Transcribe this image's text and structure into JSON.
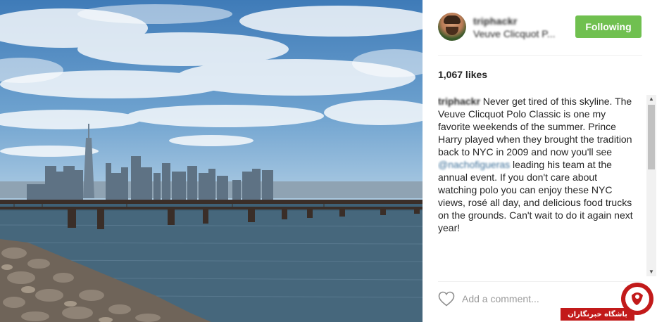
{
  "post": {
    "username": "triphackr",
    "location": "Veuve Clicquot P...",
    "follow_label": "Following",
    "likes": "1,067 likes",
    "caption": {
      "author": "triphackr",
      "text_before_mention": " Never get tired of this skyline. The Veuve Clicquot Polo Classic is one my favorite weekends of the summer. Prince Harry played when they brought the tradition back to NYC in 2009 and now you'll see ",
      "mention": "@nachofigueras",
      "text_after_mention": " leading his team at the annual event. If you don't care about watching polo you can enjoy these NYC views, rosé all day, and delicious food trucks on the grounds. Can't wait to do it again next year!"
    },
    "comment_placeholder": "Add a comment..."
  },
  "watermark": {
    "text": "باشگاه خبرنگاران"
  },
  "icons": {
    "like": "heart-outline-icon",
    "scroll_up": "arrow-up-icon",
    "scroll_down": "arrow-down-icon"
  },
  "colors": {
    "follow_button": "#70c050",
    "mention": "#3f729b",
    "watermark": "#c21a1a"
  }
}
